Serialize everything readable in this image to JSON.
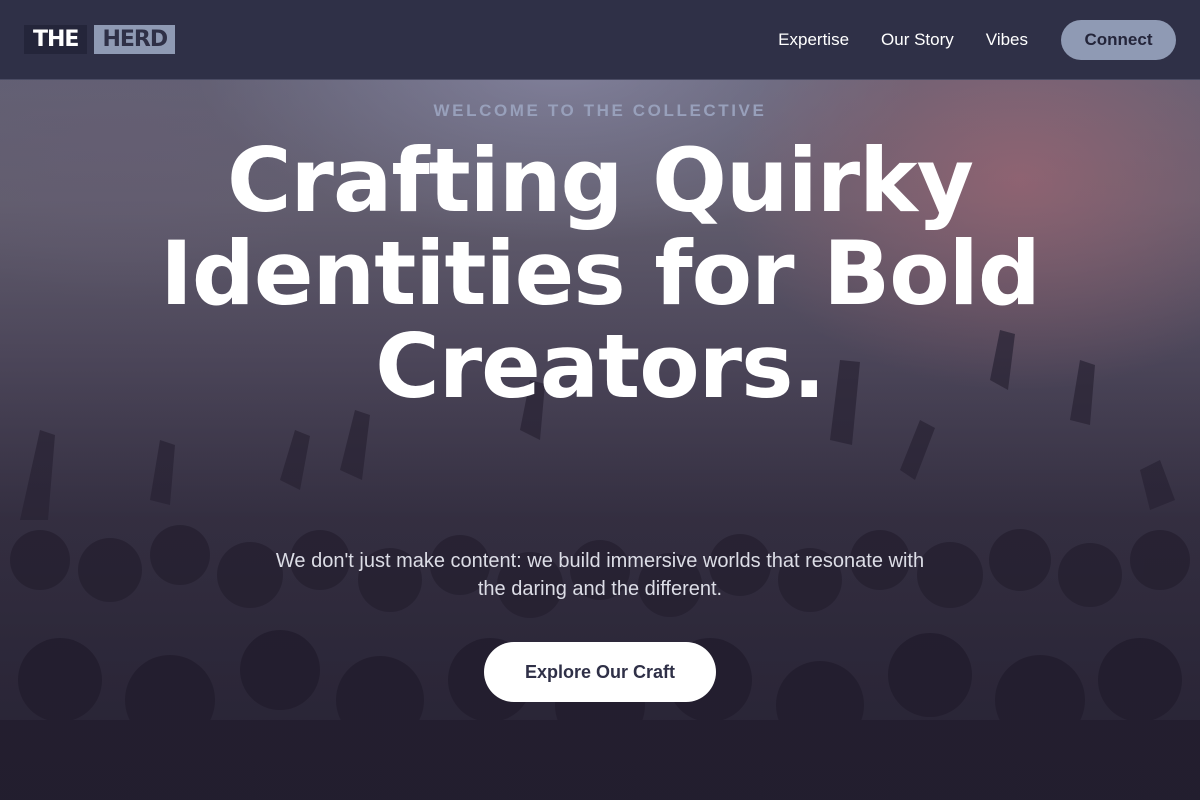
{
  "header": {
    "logo": {
      "part1": "THE",
      "part2": "HERD"
    },
    "nav": [
      {
        "label": "Expertise"
      },
      {
        "label": "Our Story"
      },
      {
        "label": "Vibes"
      }
    ],
    "cta_label": "Connect"
  },
  "hero": {
    "eyebrow": "WELCOME TO THE COLLECTIVE",
    "headline": "Crafting Quirky Identities for Bold Creators.",
    "subtext": "We don't just make content: we build immersive worlds that resonate with the daring and the different.",
    "cta_label": "Explore Our Craft",
    "background": "concert crowd with raised hands"
  },
  "colors": {
    "header_bg": "#2f3047",
    "accent": "#8f9ab4",
    "eyebrow": "#98a0bb",
    "text_light": "#ffffff"
  }
}
